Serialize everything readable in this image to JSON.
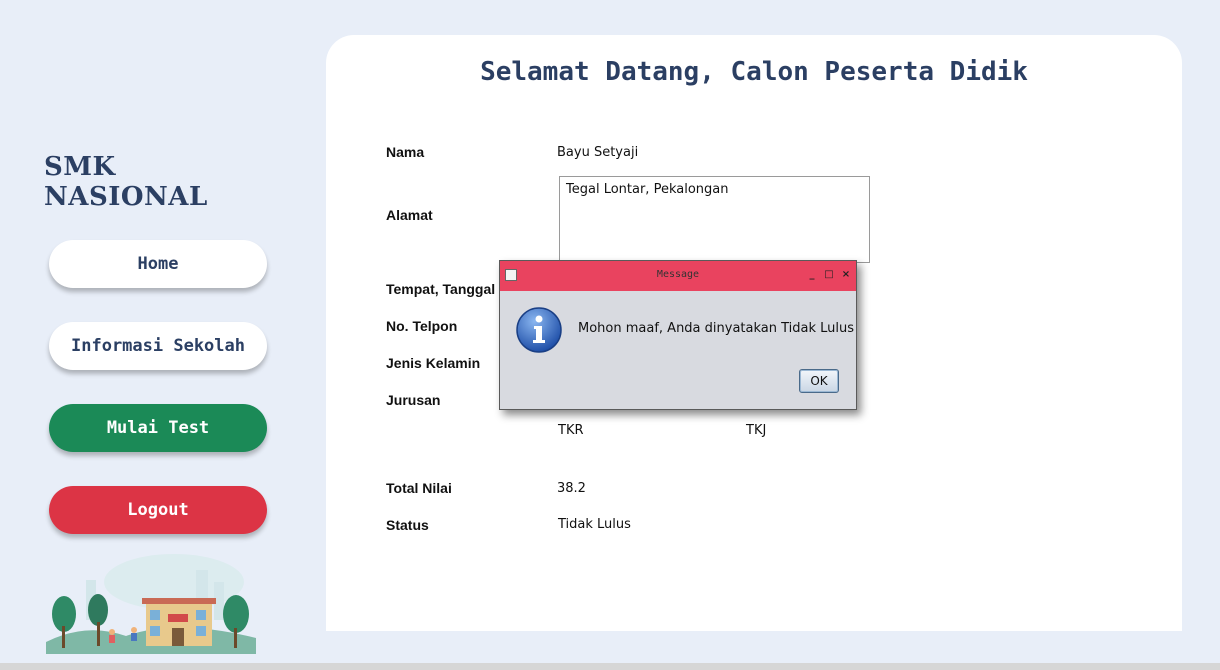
{
  "sidebar": {
    "brand": "SMK NASIONAL",
    "home_label": "Home",
    "info_label": "Informasi Sekolah",
    "test_label": "Mulai Test",
    "logout_label": "Logout"
  },
  "main": {
    "title": "Selamat Datang, Calon Peserta Didik",
    "labels": {
      "nama": "Nama",
      "alamat": "Alamat",
      "ttl": "Tempat, Tanggal L",
      "telpon": "No. Telpon",
      "jk": "Jenis Kelamin",
      "jurusan": "Jurusan",
      "total": "Total Nilai",
      "status": "Status"
    },
    "values": {
      "nama": "Bayu Setyaji",
      "alamat": "Tegal Lontar, Pekalongan",
      "jurusan_option_1": "TKR",
      "jurusan_option_2": "TKJ",
      "total": "38.2",
      "status": "Tidak Lulus"
    }
  },
  "dialog": {
    "title": "Message",
    "message": "Mohon maaf, Anda dinyatakan Tidak Lulus",
    "ok_label": "OK",
    "minimize": "_",
    "maximize": "□",
    "close": "×"
  },
  "colors": {
    "background": "#e8eef8",
    "brand": "#2b3f63",
    "test_button": "#1b8a57",
    "logout_button": "#dc3445",
    "dialog_titlebar": "#e9435f"
  }
}
